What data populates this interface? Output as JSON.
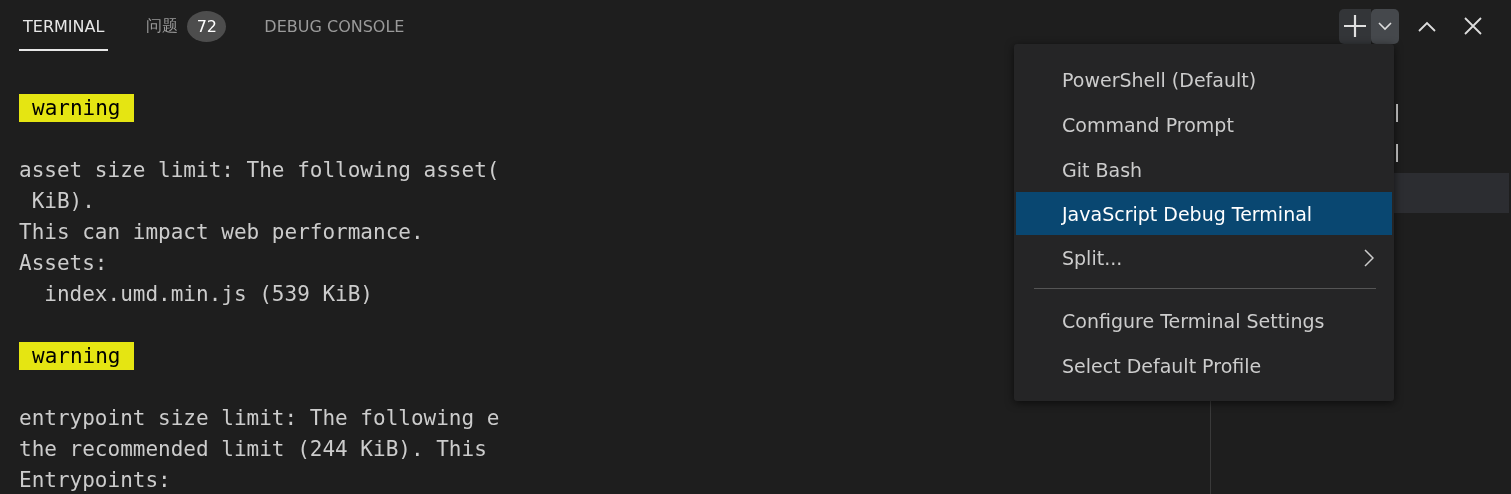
{
  "tabs": [
    {
      "label": "TERMINAL",
      "selected": true
    },
    {
      "label": "问题",
      "badge": "72",
      "selected": false
    },
    {
      "label": "DEBUG CONSOLE",
      "selected": false
    }
  ],
  "terminal": {
    "lines": [
      {
        "kind": "badge",
        "text": "warning"
      },
      {
        "kind": "blank"
      },
      {
        "kind": "text",
        "text": "asset size limit: The following asset("
      },
      {
        "kind": "text",
        "text": " KiB)."
      },
      {
        "kind": "text",
        "text": "This can impact web performance."
      },
      {
        "kind": "text",
        "text": "Assets:"
      },
      {
        "kind": "text",
        "text": "  index.umd.min.js (539 KiB)"
      },
      {
        "kind": "blank"
      },
      {
        "kind": "badge",
        "text": "warning"
      },
      {
        "kind": "blank"
      },
      {
        "kind": "text",
        "text": "entrypoint size limit: The following e"
      },
      {
        "kind": "text",
        "text": "the recommended limit (244 KiB). This"
      },
      {
        "kind": "text",
        "text": "Entrypoints:"
      }
    ]
  },
  "terminal_list": {
    "rows": [
      {
        "selected": false
      },
      {
        "selected": false
      },
      {
        "selected": true
      }
    ]
  },
  "profile_menu": {
    "items": [
      {
        "kind": "item",
        "label": "PowerShell (Default)",
        "selected": false
      },
      {
        "kind": "item",
        "label": "Command Prompt",
        "selected": false
      },
      {
        "kind": "item",
        "label": "Git Bash",
        "selected": false
      },
      {
        "kind": "item",
        "label": "JavaScript Debug Terminal",
        "selected": true
      },
      {
        "kind": "submenu",
        "label": "Split...",
        "selected": false
      },
      {
        "kind": "separator"
      },
      {
        "kind": "item",
        "label": "Configure Terminal Settings",
        "selected": false
      },
      {
        "kind": "item",
        "label": "Select Default Profile",
        "selected": false
      }
    ]
  }
}
